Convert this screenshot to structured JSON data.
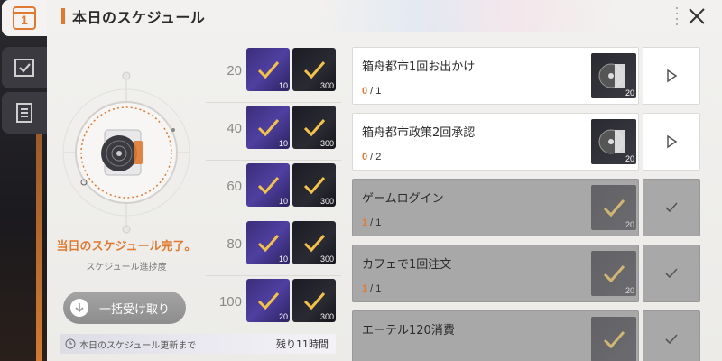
{
  "header": {
    "title": "本日のスケジュール",
    "calendar_day": "1"
  },
  "progress": {
    "complete_text": "当日のスケジュール完了。",
    "label": "スケジュール進捗度",
    "claim_button": "一括受け取り",
    "refresh_label": "本日のスケジュール更新まで",
    "refresh_remaining": "残り11時間"
  },
  "milestones": [
    {
      "points": "20",
      "reward1_qty": "10",
      "reward2_qty": "300",
      "claimed": true
    },
    {
      "points": "40",
      "reward1_qty": "10",
      "reward2_qty": "300",
      "claimed": true
    },
    {
      "points": "60",
      "reward1_qty": "10",
      "reward2_qty": "300",
      "claimed": true
    },
    {
      "points": "80",
      "reward1_qty": "10",
      "reward2_qty": "300",
      "claimed": true
    },
    {
      "points": "100",
      "reward1_qty": "20",
      "reward2_qty": "300",
      "claimed": true
    }
  ],
  "tasks": [
    {
      "name": "箱舟都市1回お出かけ",
      "current": "0",
      "total": "1",
      "reward_qty": "20",
      "done": false
    },
    {
      "name": "箱舟都市政策2回承認",
      "current": "0",
      "total": "2",
      "reward_qty": "20",
      "done": false
    },
    {
      "name": "ゲームログイン",
      "current": "1",
      "total": "1",
      "reward_qty": "20",
      "done": true
    },
    {
      "name": "カフェで1回注文",
      "current": "1",
      "total": "1",
      "reward_qty": "20",
      "done": true
    },
    {
      "name": "エーテル120消費",
      "current": "",
      "total": "",
      "reward_qty": "",
      "done": true
    }
  ],
  "colors": {
    "accent": "#e07a33",
    "done_bg": "#a8a8a8"
  }
}
